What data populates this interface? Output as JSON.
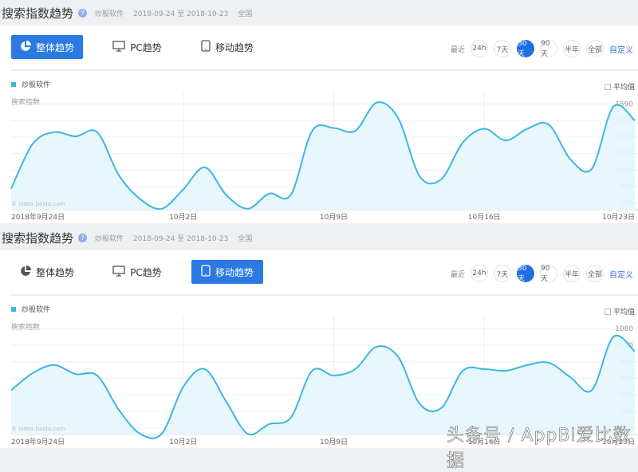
{
  "panels": [
    {
      "title": "搜索指数趋势",
      "keyword": "炒股软件",
      "date_range": "2018-09-24 至 2018-10-23",
      "region": "全国",
      "tabs": [
        {
          "label": "整体趋势",
          "active": true
        },
        {
          "label": "PC趋势",
          "active": false
        },
        {
          "label": "移动趋势",
          "active": false
        }
      ],
      "range_label": "最近",
      "ranges": [
        {
          "label": "24h"
        },
        {
          "label": "7天"
        },
        {
          "label": "30天",
          "active": true
        },
        {
          "label": "90天"
        },
        {
          "label": "半年"
        },
        {
          "label": "全部"
        }
      ],
      "custom": "自定义",
      "legend": "炒股软件",
      "avg_label": "平均值",
      "ylabel": "搜索指数",
      "watermark": "© index.baidu.com"
    },
    {
      "title": "搜索指数趋势",
      "keyword": "炒股软件",
      "date_range": "2018-09-24 至 2018-10-23",
      "region": "全国",
      "tabs": [
        {
          "label": "整体趋势",
          "active": false
        },
        {
          "label": "PC趋势",
          "active": false
        },
        {
          "label": "移动趋势",
          "active": true
        }
      ],
      "range_label": "最近",
      "ranges": [
        {
          "label": "24h"
        },
        {
          "label": "7天"
        },
        {
          "label": "30天",
          "active": true
        },
        {
          "label": "90天"
        },
        {
          "label": "半年"
        },
        {
          "label": "全部"
        }
      ],
      "custom": "自定义",
      "legend": "炒股软件",
      "avg_label": "平均值",
      "ylabel": "搜索指数",
      "watermark": "© index.baidu.com"
    }
  ],
  "overlay_watermark": "头条号 / AppBi爱比数据",
  "chart_data": [
    {
      "type": "area",
      "title": "整体趋势",
      "series": [
        {
          "name": "炒股软件",
          "color": "#3bb7e2",
          "values": [
            975,
            1300,
            1385,
            1355,
            1385,
            1075,
            900,
            830,
            970,
            1130,
            930,
            830,
            940,
            930,
            1395,
            1415,
            1395,
            1600,
            1485,
            1065,
            1045,
            1310,
            1410,
            1325,
            1410,
            1440,
            1190,
            1120,
            1570,
            1470
          ]
        }
      ],
      "xticks": [
        "2018年9月24日",
        "10月2日",
        "10月9日",
        "10月16日",
        "10月23日"
      ],
      "xtick_index": [
        0,
        8,
        15,
        22,
        29
      ],
      "yticks": [
        870,
        990,
        1110,
        1230,
        1350,
        1470,
        1590
      ],
      "ylim": [
        823,
        1650
      ],
      "grid": true
    },
    {
      "type": "area",
      "title": "移动趋势",
      "series": [
        {
          "name": "炒股软件",
          "color": "#3bb7e2",
          "values": [
            820,
            892,
            926,
            888,
            882,
            738,
            636,
            636,
            834,
            909,
            772,
            636,
            677,
            704,
            902,
            882,
            909,
            1004,
            960,
            762,
            745,
            902,
            909,
            902,
            926,
            936,
            875,
            820,
            1045,
            984
          ]
        }
      ],
      "xticks": [
        "2018年9月24日",
        "10月2日",
        "10月9日",
        "10月16日",
        "10月23日"
      ],
      "xtick_index": [
        0,
        8,
        15,
        22,
        29
      ],
      "yticks": [
        660,
        730,
        800,
        870,
        940,
        1010,
        1080
      ],
      "ylim": [
        633,
        1114
      ],
      "grid": true
    }
  ]
}
